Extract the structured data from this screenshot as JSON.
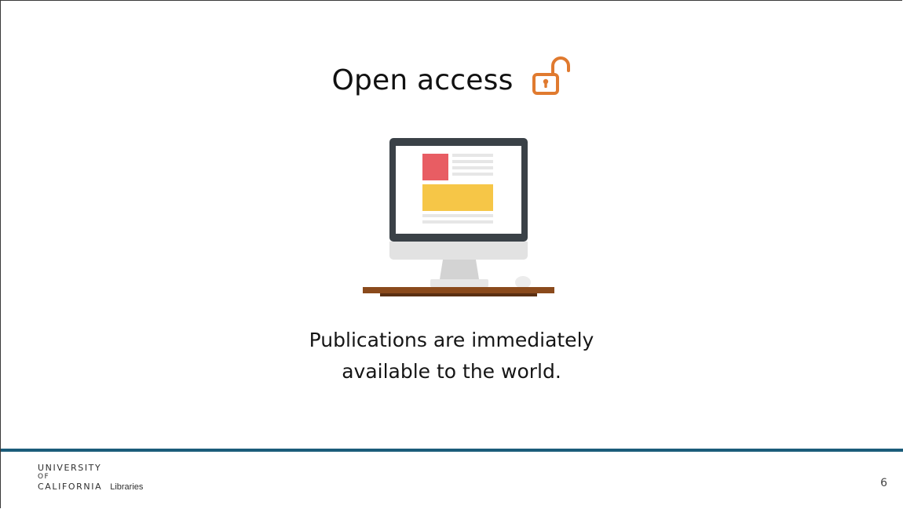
{
  "slide": {
    "title": "Open access",
    "caption_line1": "Publications are immediately",
    "caption_line2": "available to the world.",
    "page_number": "6"
  },
  "footer": {
    "logo_line1": "UNIVERSITY",
    "logo_line2": "OF",
    "logo_line3": "CALIFORNIA",
    "logo_libraries": "Libraries"
  },
  "icons": {
    "title_icon": "unlocked-padlock-icon",
    "illustration": "desktop-computer-icon"
  },
  "colors": {
    "lock_orange": "#e07a2f",
    "footer_rule": "#1b5c7a",
    "screen_frame": "#3a4147",
    "red_block": "#e85d63",
    "yellow_block": "#f6c647",
    "desk": "#6b3a18"
  }
}
